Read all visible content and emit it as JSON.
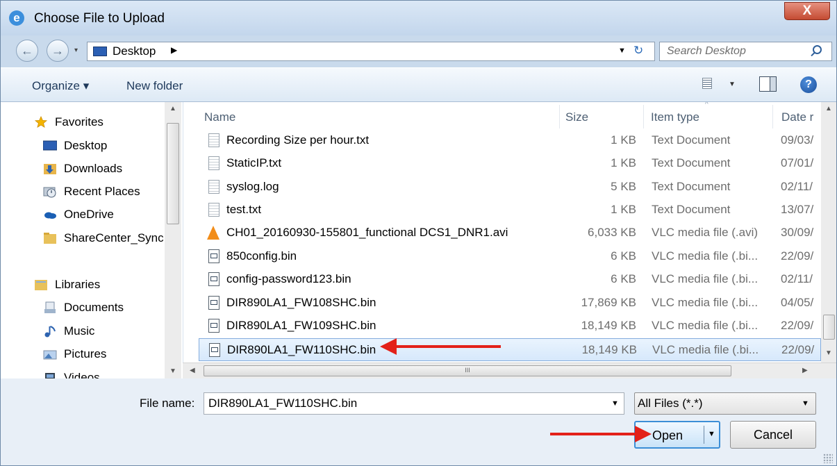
{
  "window": {
    "title": "Choose File to Upload",
    "close_label": "X",
    "app_icon": "e"
  },
  "navigation": {
    "back_icon": "←",
    "forward_icon": "→",
    "dropdown_icon": "▾",
    "address": "Desktop",
    "address_arrow": "▶",
    "address_dropdown_icon": "▼",
    "refresh_icon": "↻",
    "search_placeholder": "Search Desktop"
  },
  "toolbar": {
    "organize_label": "Organize ▾",
    "new_folder_label": "New folder",
    "views_dropdown_icon": "▼",
    "help_label": "?"
  },
  "sidebar": {
    "items": [
      {
        "label": "Favorites",
        "icon": "star-icon",
        "color": "#f4b400"
      },
      {
        "label": "Desktop",
        "icon": "desktop-icon",
        "color": "#2b5fb4"
      },
      {
        "label": "Downloads",
        "icon": "downloads-folder-icon",
        "color": "#e8b54a"
      },
      {
        "label": "Recent Places",
        "icon": "recent-places-icon",
        "color": "#8a9bb0"
      },
      {
        "label": "OneDrive",
        "icon": "onedrive-icon",
        "color": "#1a5fb4"
      },
      {
        "label": "ShareCenter_Sync",
        "icon": "folder-icon",
        "color": "#e8c15a"
      },
      {
        "label": "Libraries",
        "icon": "libraries-icon",
        "color": "#e8c15a"
      },
      {
        "label": "Documents",
        "icon": "documents-icon",
        "color": "#9fb4cc"
      },
      {
        "label": "Music",
        "icon": "music-icon",
        "color": "#2d63b0"
      },
      {
        "label": "Pictures",
        "icon": "pictures-icon",
        "color": "#7da7d8"
      },
      {
        "label": "Videos",
        "icon": "videos-icon",
        "color": "#33414f"
      }
    ]
  },
  "files": {
    "columns": {
      "name": "Name",
      "size": "Size",
      "type": "Item type",
      "date": "Date r"
    },
    "rows": [
      {
        "name": "Recording Size per hour.txt",
        "size": "1 KB",
        "type": "Text Document",
        "date": "09/03/",
        "icon": "text-file-icon"
      },
      {
        "name": "StaticIP.txt",
        "size": "1 KB",
        "type": "Text Document",
        "date": "07/01/",
        "icon": "text-file-icon"
      },
      {
        "name": "syslog.log",
        "size": "5 KB",
        "type": "Text Document",
        "date": "02/11/",
        "icon": "text-file-icon"
      },
      {
        "name": "test.txt",
        "size": "1 KB",
        "type": "Text Document",
        "date": "13/07/",
        "icon": "text-file-icon"
      },
      {
        "name": "CH01_20160930-155801_functional DCS1_DNR1.avi",
        "size": "6,033 KB",
        "type": "VLC media file (.avi)",
        "date": "30/09/",
        "icon": "vlc-cone-icon"
      },
      {
        "name": "850config.bin",
        "size": "6 KB",
        "type": "VLC media file (.bi...",
        "date": "22/09/",
        "icon": "bin-file-icon"
      },
      {
        "name": "config-password123.bin",
        "size": "6 KB",
        "type": "VLC media file (.bi...",
        "date": "02/11/",
        "icon": "bin-file-icon"
      },
      {
        "name": "DIR890LA1_FW108SHC.bin",
        "size": "17,869 KB",
        "type": "VLC media file (.bi...",
        "date": "04/05/",
        "icon": "bin-file-icon"
      },
      {
        "name": "DIR890LA1_FW109SHC.bin",
        "size": "18,149 KB",
        "type": "VLC media file (.bi...",
        "date": "22/09/",
        "icon": "bin-file-icon"
      },
      {
        "name": "DIR890LA1_FW110SHC.bin",
        "size": "18,149 KB",
        "type": "VLC media file (.bi...",
        "date": "22/09/",
        "icon": "bin-file-icon"
      }
    ],
    "selected_index": 9,
    "hscroll_grip": "III"
  },
  "footer": {
    "file_name_label": "File name:",
    "file_name_value": "DIR890LA1_FW110SHC.bin",
    "file_type_value": "All Files (*.*)",
    "dropdown_icon": "▼",
    "open_label": "Open",
    "cancel_label": "Cancel"
  },
  "colors": {
    "annotation_arrow": "#e32119",
    "selection": "#d6e8fb",
    "close_button": "#c44b32"
  }
}
